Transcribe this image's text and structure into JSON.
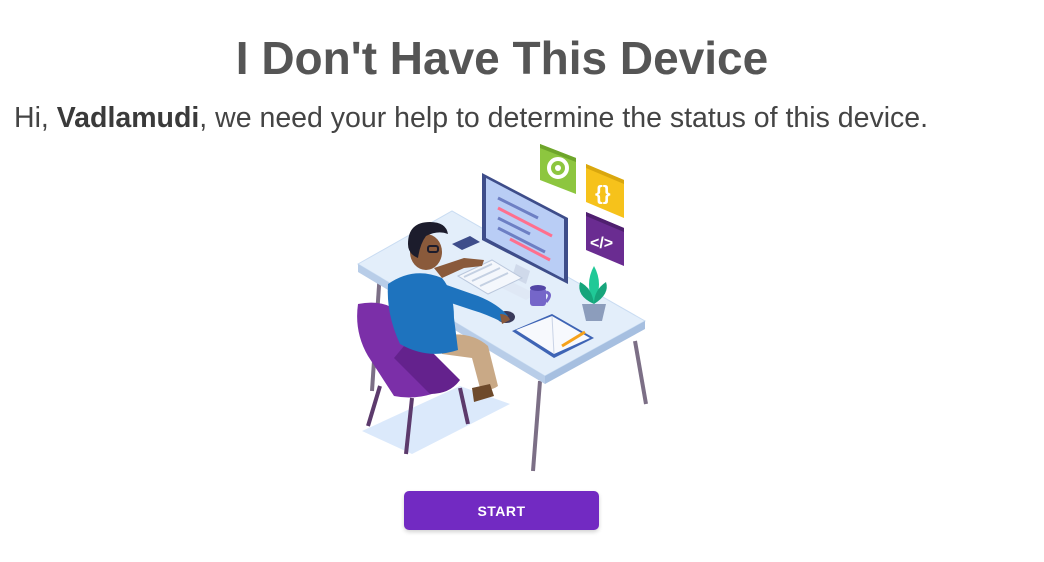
{
  "page": {
    "title": "I Don't Have This Device",
    "greeting_prefix": "Hi, ",
    "user_name": "Vadlamudi",
    "greeting_suffix": ", we need your help to determine the status of this device."
  },
  "illustration": {
    "icons": [
      "gear-icon",
      "braces-icon",
      "code-icon"
    ],
    "colors": {
      "gear_tile": "#8dc63f",
      "braces_tile": "#f6c21b",
      "code_tile": "#6a2c91",
      "chair": "#7b2fa8",
      "shirt": "#1e73be",
      "desk": "#e3eefa"
    }
  },
  "actions": {
    "start_label": "START",
    "start_color": "#722ac2"
  }
}
